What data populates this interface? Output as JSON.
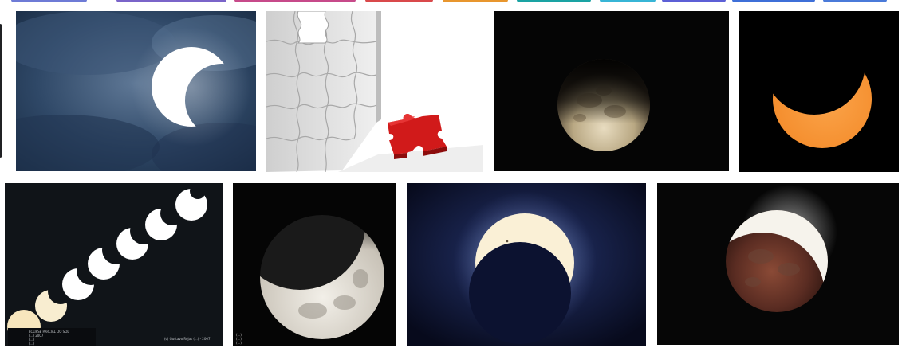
{
  "chips": [
    {
      "color": "#6e7bd6"
    },
    {
      "color": "#7a64c9"
    },
    {
      "color": "#c74a8a"
    },
    {
      "color": "#d9494b"
    },
    {
      "color": "#e8962e"
    },
    {
      "color": "#1aa3a3"
    },
    {
      "color": "#37b5d6"
    },
    {
      "color": "#5c5fd6"
    },
    {
      "color": "#3e6fd8"
    },
    {
      "color": "#4a7ad9"
    }
  ],
  "images": [
    {
      "name": "partial-solar-eclipse-clouds"
    },
    {
      "name": "puzzle-missing-piece"
    },
    {
      "name": "lunar-eclipse-dark"
    },
    {
      "name": "orange-crescent-sun"
    },
    {
      "name": "partial-solar-eclipse-sequence",
      "caption_lines": [
        "ECLIPSE PARCIAL DO SOL",
        "(...) 2007",
        "(...)",
        "(...)"
      ],
      "credit": "(c) Gustavo Rojas (...) - 2007"
    },
    {
      "name": "lunar-eclipse-crescent-moon",
      "caption_lines": [
        "(...)",
        "(...)",
        "(...)"
      ]
    },
    {
      "name": "annular-crescent-sun-glow"
    },
    {
      "name": "lunar-eclipse-red-moon"
    }
  ]
}
